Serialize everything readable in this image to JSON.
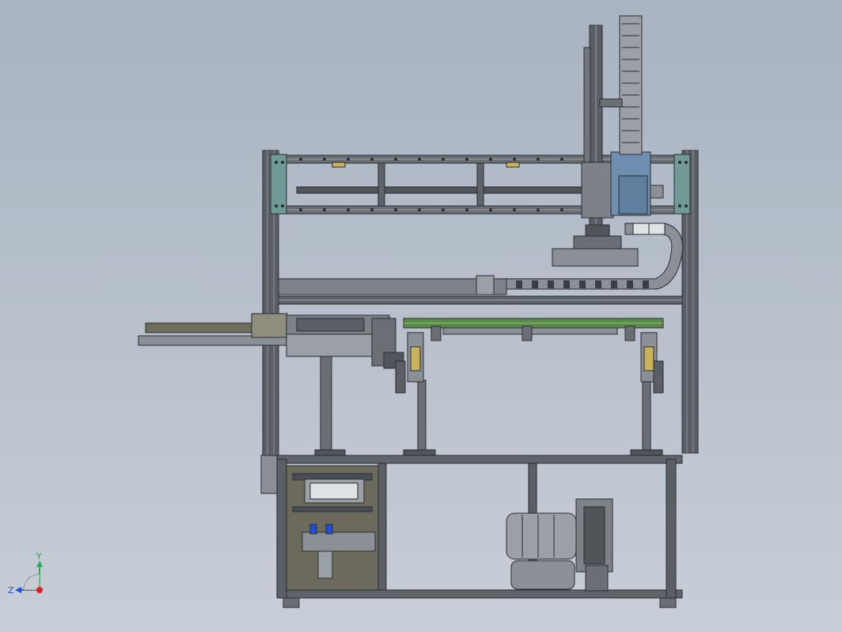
{
  "triad": {
    "x_label": "",
    "y_label": "Y",
    "z_label": "Z",
    "y_color": "#22b14c",
    "z_color": "#1f4fd8",
    "origin_color": "#e02020"
  },
  "colors": {
    "frame": "#4a4f55",
    "frame_light": "#8a9096",
    "steel": "#9aa0a6",
    "plate_teal": "#6f9a96",
    "plate_blue": "#6f8fb0",
    "conveyor_green": "#5a8a4a",
    "panel": "#6b6a5c",
    "dark": "#2e3236"
  }
}
